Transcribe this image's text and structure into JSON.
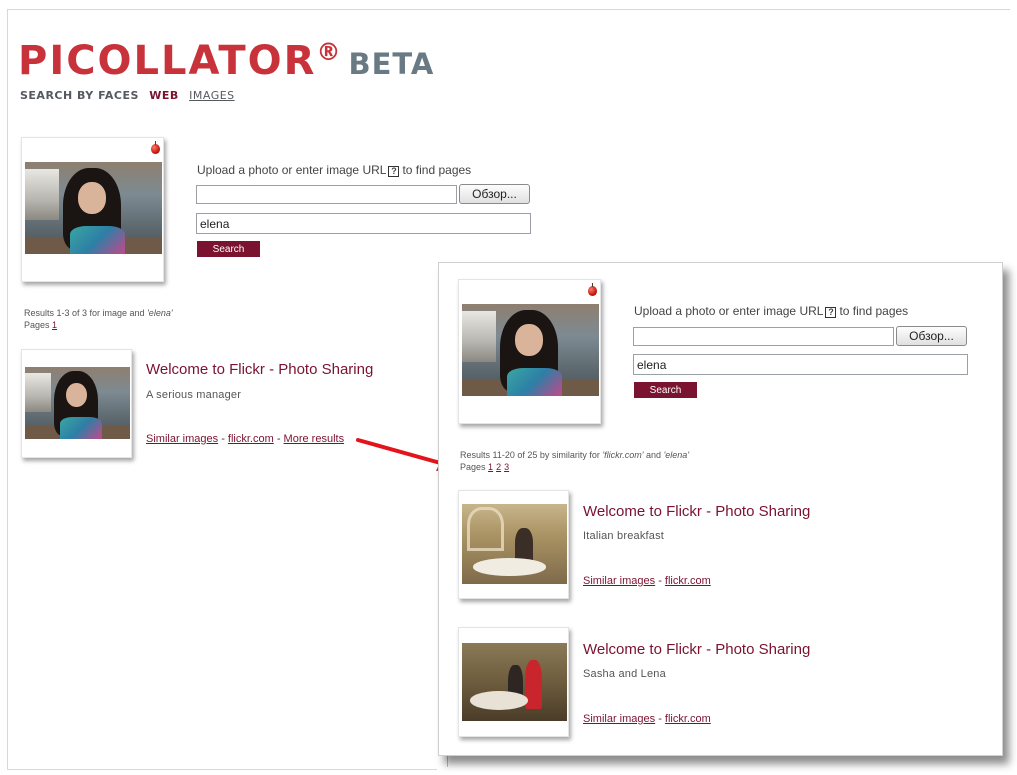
{
  "logo": {
    "main": "PICOLLATOR",
    "registered": "®",
    "beta": "BETA"
  },
  "nav": {
    "search_by_faces": "SEARCH BY FACES",
    "web": "WEB",
    "images": "IMAGES"
  },
  "search": {
    "upload_text_before": "Upload a photo or enter image URL",
    "help_glyph": "?",
    "upload_text_after": "to find pages",
    "browse_label": "Обзор...",
    "query_value": "elena",
    "search_label": "Search"
  },
  "main_results": {
    "summary_prefix": "Results 1-3 of 3 for image and",
    "summary_query": "'elena'",
    "pages_label": "Pages",
    "pages": [
      "1"
    ],
    "items": [
      {
        "title": "Welcome to Flickr - Photo Sharing",
        "description": "A serious manager",
        "link_similar": "Similar images",
        "separator": " - ",
        "link_domain": "flickr.com",
        "link_more": "More results"
      }
    ]
  },
  "overlay": {
    "search": {
      "upload_text_before": "Upload a photo or enter image URL",
      "help_glyph": "?",
      "upload_text_after": "to find pages",
      "browse_label": "Обзор...",
      "query_value": "elena",
      "search_label": "Search"
    },
    "summary_prefix": "Results 11-20 of 25 by similarity for",
    "summary_domain": "'flickr.com'",
    "summary_and": "and",
    "summary_query": "'elena'",
    "pages_label": "Pages",
    "pages": [
      "1",
      "2",
      "3"
    ],
    "items": [
      {
        "title": "Welcome to Flickr - Photo Sharing",
        "description": "Italian breakfast",
        "link_similar": "Similar images",
        "separator": " - ",
        "link_domain": "flickr.com"
      },
      {
        "title": "Welcome to Flickr - Photo Sharing",
        "description": "Sasha and Lena",
        "link_similar": "Similar images",
        "separator": " - ",
        "link_domain": "flickr.com"
      }
    ]
  },
  "colors": {
    "logo_red": "#c8323a",
    "accent_maroon": "#7a1230",
    "beta_gray": "#6a7a85",
    "arrow_red": "#e3141c"
  }
}
